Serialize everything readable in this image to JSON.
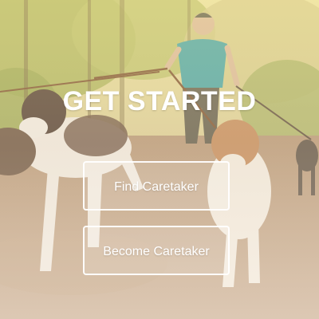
{
  "header": {
    "title": "GET STARTED"
  },
  "actions": {
    "find_label": "Find Caretaker",
    "become_label": "Become Caretaker"
  },
  "colors": {
    "text": "#ffffff",
    "button_border": "#ffffff",
    "overlay_tint": "#fff0c8"
  },
  "background": {
    "icon": "dog-walker-photo"
  }
}
